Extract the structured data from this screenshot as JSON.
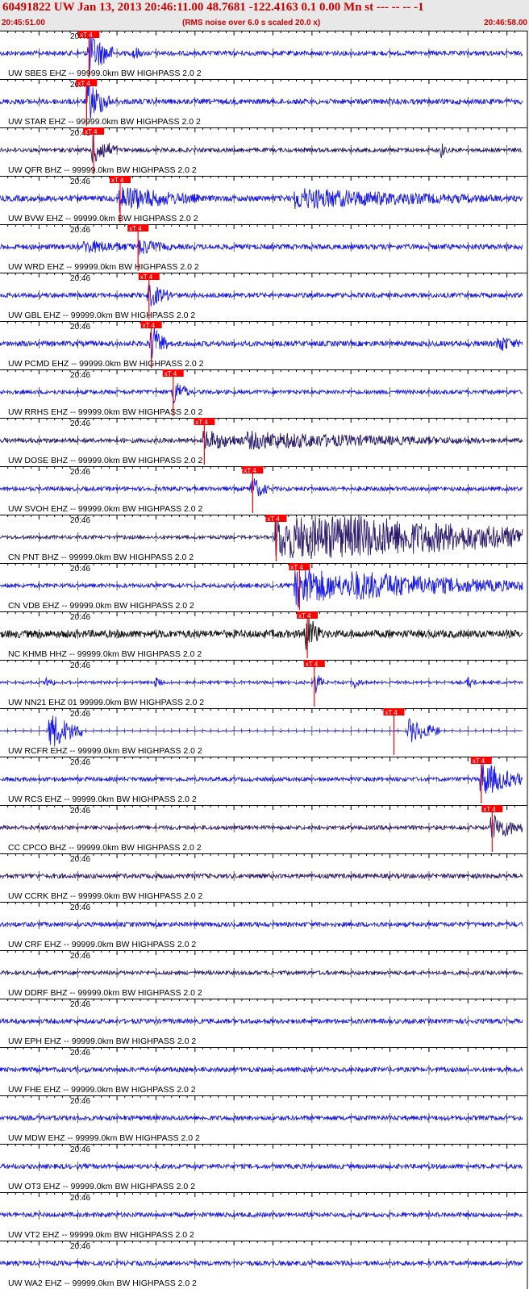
{
  "header": {
    "title": "60491822 UW Jan 13, 2013 20:46:11.00   48.7681 -122.4163  0.1 0.00 Mn st --- -- --  -1",
    "start_time": "20:45:51.00",
    "scale_note": "(RMS noise over 6.0 s scaled 20.0 x)",
    "end_time": "20:46:58.00"
  },
  "colors": {
    "trace_blue": "#1a1ae6",
    "trace_dark": "#2a1a6a",
    "trace_black": "#111111",
    "pick_red": "#ff0000",
    "header_bg": "#e8e8e8",
    "header_text": "#cc0000"
  },
  "chart_data": {
    "type": "line",
    "x_range_seconds": [
      0,
      67
    ],
    "time_tick_label": "20:46",
    "time_tick_seconds": 9,
    "pick_label": "xT 4",
    "filter": "BW  HIGHPASS  2.0  2",
    "traces": [
      {
        "label": "UW SBES EHZ -- 99999.0km BW  HIGHPASS  2.0  2",
        "color": "#1a1ae6",
        "pick": 11.3,
        "amp": 0.35,
        "events": [
          {
            "t": 11.5,
            "a": 3.5,
            "d": 3
          },
          {
            "t": 17.2,
            "a": 1.5,
            "d": 1
          }
        ]
      },
      {
        "label": "UW STAR EHZ -- 99999.0km BW  HIGHPASS  2.0  2",
        "color": "#1a1ae6",
        "pick": 11.0,
        "amp": 0.4,
        "events": [
          {
            "t": 11.2,
            "a": 3.5,
            "d": 3
          }
        ]
      },
      {
        "label": "UW QFR BHZ -- 99999.0km BW  HIGHPASS  2.0  2",
        "color": "#2a1a6a",
        "pick": 11.9,
        "amp": 0.3,
        "events": [
          {
            "t": 12.0,
            "a": 2.5,
            "d": 3
          },
          {
            "t": 56.5,
            "a": 1.4,
            "d": 1
          }
        ]
      },
      {
        "label": "UW BVW EHZ -- 99999.0km BW  HIGHPASS  2.0  2",
        "color": "#1a1ae6",
        "pick": 15.3,
        "amp": 0.45,
        "events": [
          {
            "t": 15.5,
            "a": 2.2,
            "d": 10
          },
          {
            "t": 38,
            "a": 1.8,
            "d": 26
          }
        ]
      },
      {
        "label": "UW WRD EHZ -- 99999.0km BW  HIGHPASS  2.0  2",
        "color": "#1a1ae6",
        "pick": 17.6,
        "amp": 0.4,
        "events": [
          {
            "t": 11,
            "a": 1.2,
            "d": 9
          },
          {
            "t": 18,
            "a": 1.5,
            "d": 4
          }
        ]
      },
      {
        "label": "UW GBL EHZ -- 99999.0km BW  HIGHPASS  2.0  2",
        "color": "#1a1ae6",
        "pick": 19.0,
        "amp": 0.35,
        "events": [
          {
            "t": 19.2,
            "a": 2.0,
            "d": 3
          }
        ]
      },
      {
        "label": "UW PCMD EHZ -- 99999.0km BW  HIGHPASS  2.0  2",
        "color": "#1a1ae6",
        "pick": 19.3,
        "amp": 0.4,
        "events": [
          {
            "t": 19.5,
            "a": 3.0,
            "d": 2
          },
          {
            "t": 64,
            "a": 1.5,
            "d": 3
          }
        ]
      },
      {
        "label": "UW RRHS EHZ -- 99999.0km BW  HIGHPASS  2.0  2",
        "color": "#1a1ae6",
        "pick": 22.1,
        "amp": 0.3,
        "events": [
          {
            "t": 22.3,
            "a": 2.2,
            "d": 2
          }
        ]
      },
      {
        "label": "UW DOSE BHZ -- 99999.0km BW  HIGHPASS  2.0  2",
        "color": "#2a1a6a",
        "pick": 26.1,
        "amp": 0.35,
        "events": [
          {
            "t": 26.3,
            "a": 1.8,
            "d": 6
          },
          {
            "t": 32,
            "a": 1.5,
            "d": 30
          }
        ]
      },
      {
        "label": "UW SVOH EHZ -- 99999.0km BW  HIGHPASS  2.0  2",
        "color": "#1a1ae6",
        "pick": 32.3,
        "amp": 0.3,
        "events": [
          {
            "t": 32.4,
            "a": 2.0,
            "d": 2
          }
        ]
      },
      {
        "label": "CN PNT BHZ -- 99999.0km BW  HIGHPASS  2.0  2",
        "color": "#2a1a6a",
        "pick": 35.3,
        "amp": 0.25,
        "events": [
          {
            "t": 35.5,
            "a": 5,
            "d": 32
          }
        ]
      },
      {
        "label": "CN VDB EHZ -- 99999.0km BW  HIGHPASS  2.0  2",
        "color": "#1a1ae6",
        "pick": 38.3,
        "amp": 0.3,
        "events": [
          {
            "t": 38,
            "a": 4,
            "d": 8
          },
          {
            "t": 45,
            "a": 2.5,
            "d": 22
          }
        ]
      },
      {
        "label": "NC KHMB HHZ -- 99999.0km BW  HIGHPASS  2.0  2",
        "color": "#111111",
        "pick": 39.3,
        "amp": 0.6,
        "events": [
          {
            "t": 39.3,
            "a": 3.5,
            "d": 2
          }
        ]
      },
      {
        "label": "UW NN21 EHZ 01 99999.0km BW  HIGHPASS  2.0  2",
        "color": "#1a1ae6",
        "pick": 40.2,
        "amp": 0.2,
        "events": [
          {
            "t": 6,
            "a": 1.3,
            "d": 1
          },
          {
            "t": 20,
            "a": 1.3,
            "d": 1
          },
          {
            "t": 40.5,
            "a": 2.0,
            "d": 1
          },
          {
            "t": 45.5,
            "a": 1.2,
            "d": 1
          },
          {
            "t": 60,
            "a": 1.2,
            "d": 1
          }
        ]
      },
      {
        "label": "UW RCFR EHZ -- 99999.0km BW  HIGHPASS  2.0  2",
        "color": "#1a1ae6",
        "pick": 50.4,
        "amp": 0.05,
        "events": [
          {
            "t": 6.5,
            "a": 3.0,
            "d": 4
          },
          {
            "t": 52.5,
            "a": 2.0,
            "d": 4
          }
        ]
      },
      {
        "label": "UW RCS EHZ -- 99999.0km BW  HIGHPASS  2.0  2",
        "color": "#1a1ae6",
        "pick": 61.6,
        "amp": 0.3,
        "events": [
          {
            "t": 61.8,
            "a": 3.0,
            "d": 5
          }
        ]
      },
      {
        "label": "CC CPCO BHZ -- 99999.0km BW  HIGHPASS  2.0  2",
        "color": "#2a1a6a",
        "pick": 63.0,
        "amp": 0.3,
        "events": [
          {
            "t": 63.2,
            "a": 2.2,
            "d": 4
          }
        ]
      },
      {
        "label": "UW CCRK BHZ -- 99999.0km BW  HIGHPASS  2.0  2",
        "color": "#2a1a6a",
        "pick": null,
        "amp": 0.35,
        "events": []
      },
      {
        "label": "UW CRF EHZ -- 99999.0km BW  HIGHPASS  2.0  2",
        "color": "#1a1ae6",
        "pick": null,
        "amp": 0.35,
        "events": []
      },
      {
        "label": "UW DDRF BHZ -- 99999.0km BW  HIGHPASS  2.0  2",
        "color": "#2a1a6a",
        "pick": null,
        "amp": 0.3,
        "events": []
      },
      {
        "label": "UW EPH EHZ -- 99999.0km BW  HIGHPASS  2.0  2",
        "color": "#1a1ae6",
        "pick": null,
        "amp": 0.35,
        "events": []
      },
      {
        "label": "UW FHE EHZ -- 99999.0km BW  HIGHPASS  2.0  2",
        "color": "#1a1ae6",
        "pick": null,
        "amp": 0.35,
        "events": []
      },
      {
        "label": "UW MDW EHZ -- 99999.0km BW  HIGHPASS  2.0  2",
        "color": "#1a1ae6",
        "pick": null,
        "amp": 0.35,
        "events": []
      },
      {
        "label": "UW OT3 EHZ -- 99999.0km BW  HIGHPASS  2.0  2",
        "color": "#1a1ae6",
        "pick": null,
        "amp": 0.35,
        "events": []
      },
      {
        "label": "UW VT2 EHZ -- 99999.0km BW  HIGHPASS  2.0  2",
        "color": "#1a1ae6",
        "pick": null,
        "amp": 0.35,
        "events": []
      },
      {
        "label": "UW WA2 EHZ -- 99999.0km BW  HIGHPASS  2.0  2",
        "color": "#1a1ae6",
        "pick": null,
        "amp": 0.35,
        "events": []
      }
    ]
  }
}
